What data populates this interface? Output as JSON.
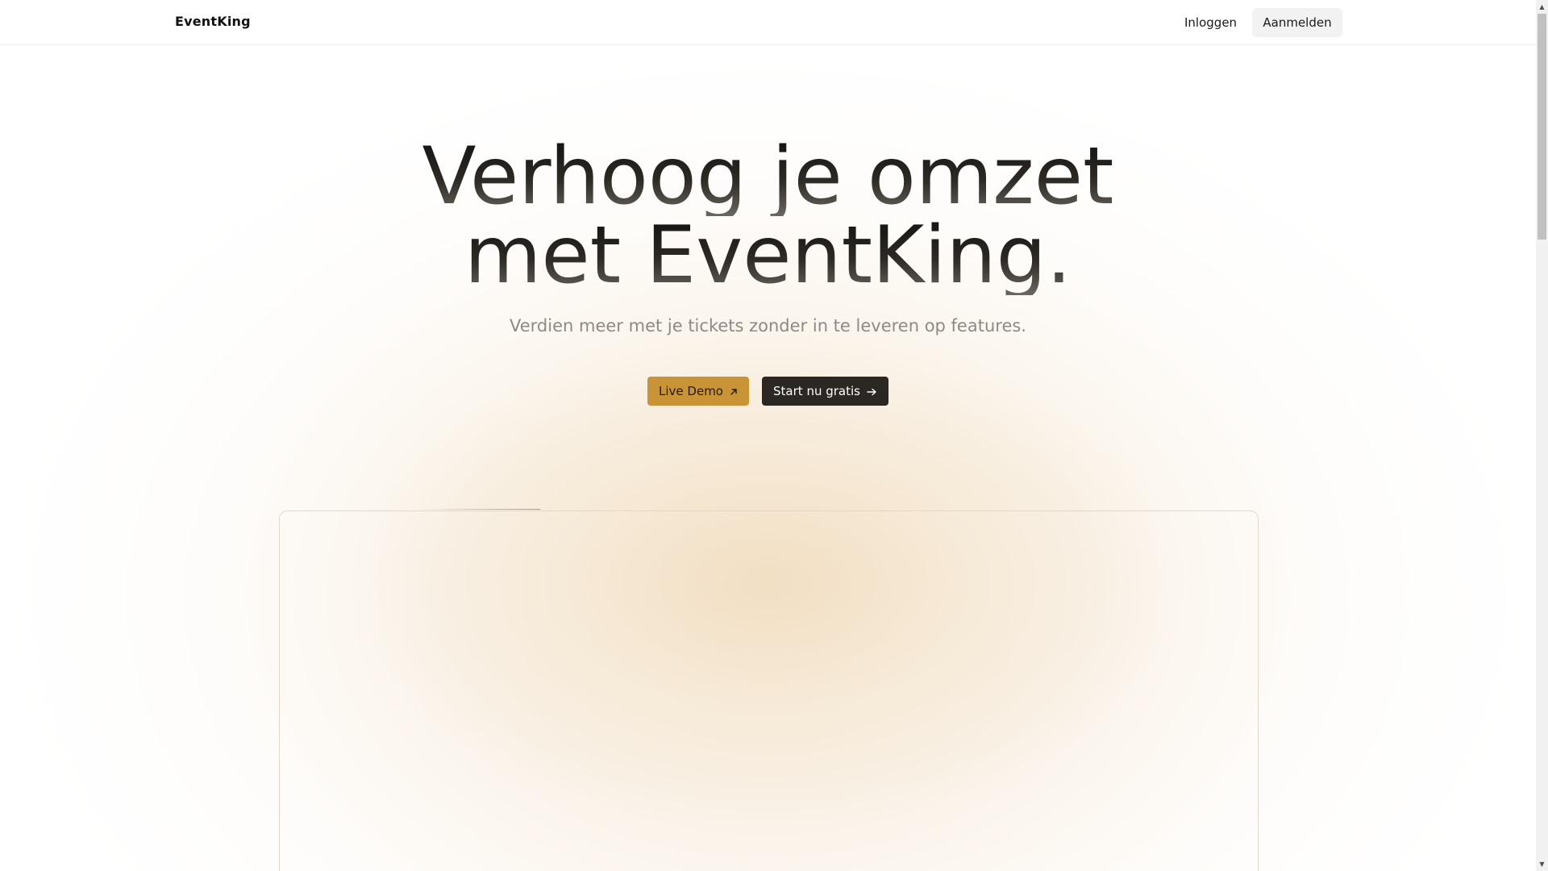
{
  "nav": {
    "brand": "EventKing",
    "login_label": "Inloggen",
    "signup_label": "Aanmelden"
  },
  "hero": {
    "title_line1": "Verhoog je omzet",
    "title_line2": "met EventKing.",
    "subtitle": "Verdien meer met je tickets zonder in te leveren op features.",
    "demo_button": "Live Demo",
    "demo_icon": "arrow-up-right-icon",
    "start_button": "Start nu gratis",
    "start_icon": "arrow-right-icon"
  },
  "colors": {
    "accent": "#c99436",
    "dark_button": "#2b2722",
    "subtitle_text": "#8d8a86",
    "glow": "#f0dab9"
  }
}
